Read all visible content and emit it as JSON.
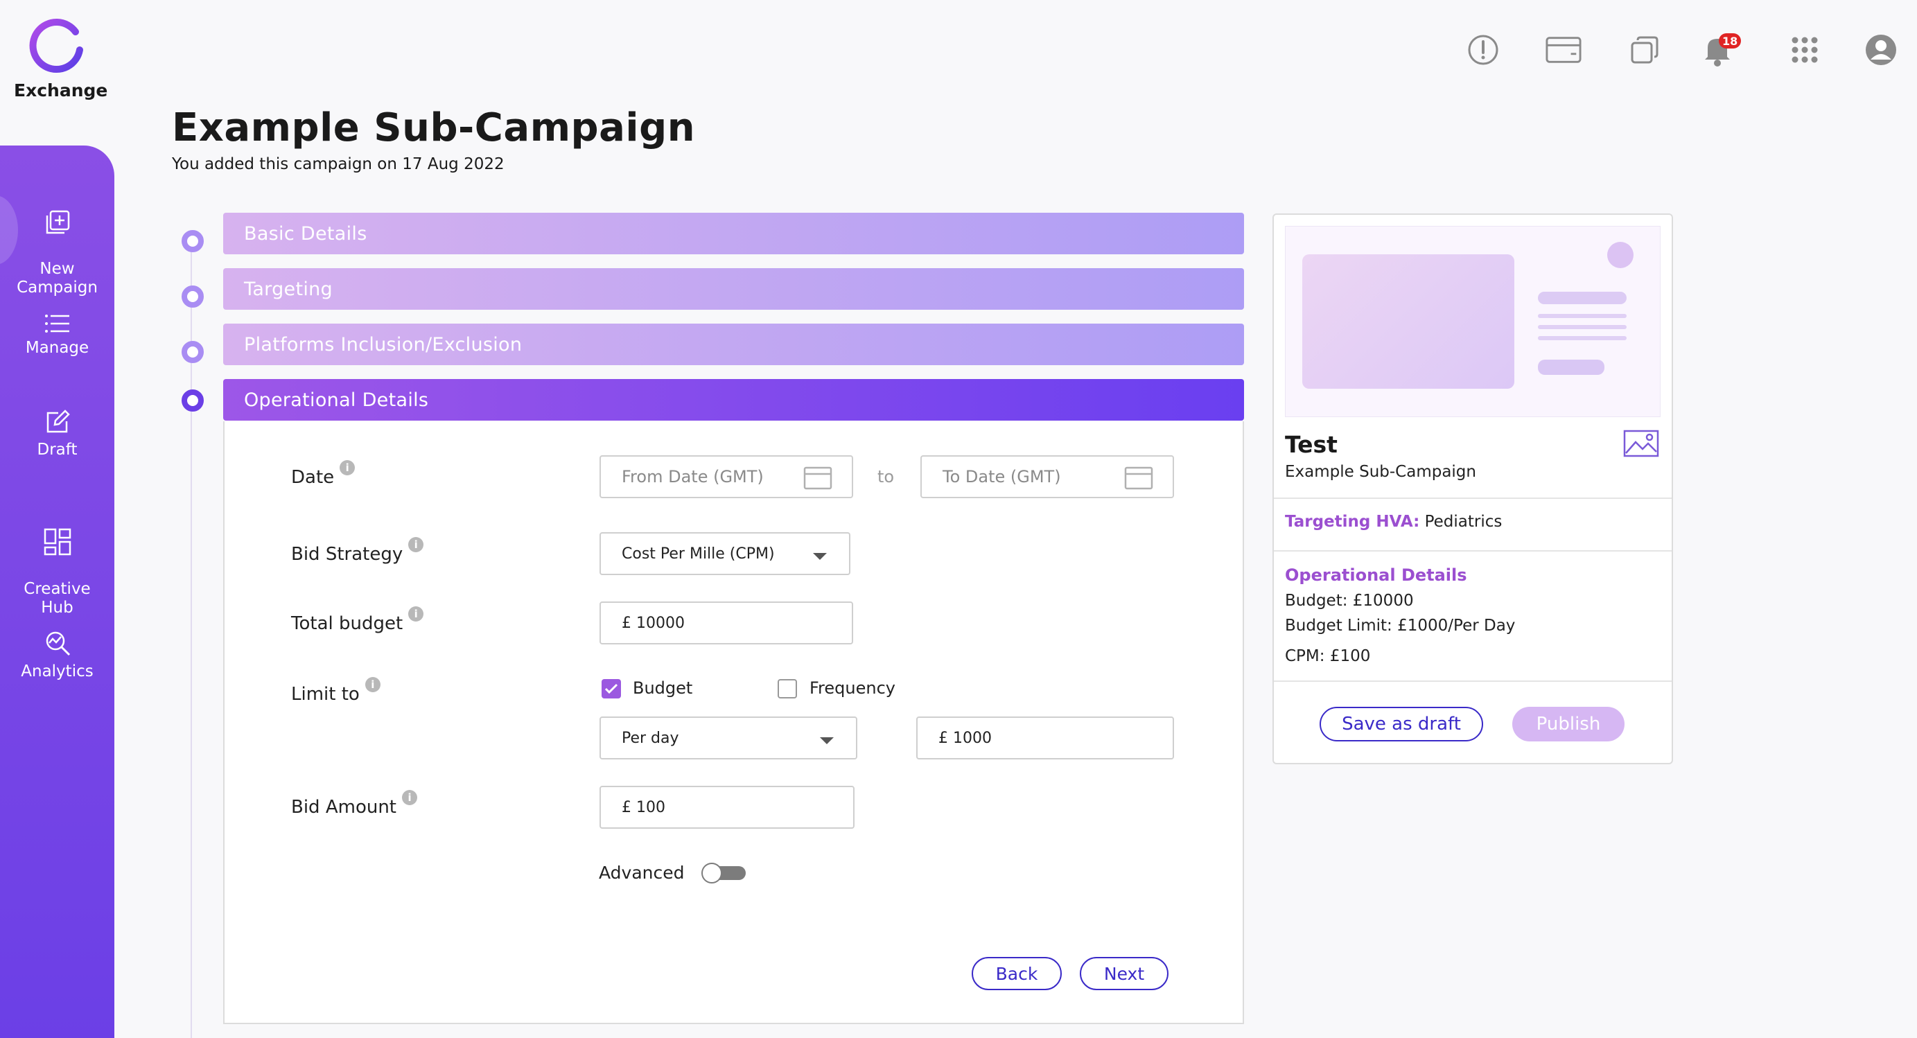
{
  "app": {
    "logo_text": "Exchange"
  },
  "sidebar": {
    "items": [
      {
        "label": "New\nCampaign",
        "icon": "new-campaign-icon"
      },
      {
        "label": "Manage",
        "icon": "list-icon"
      },
      {
        "label": "Draft",
        "icon": "edit-icon"
      },
      {
        "label": "Creative\nHub",
        "icon": "grid-icon"
      },
      {
        "label": "Analytics",
        "icon": "analytics-icon"
      }
    ]
  },
  "topbar": {
    "icons": [
      "alert-icon",
      "card-icon",
      "copy-icon",
      "bell-icon",
      "apps-icon",
      "user-icon"
    ],
    "notification_count": "18"
  },
  "page": {
    "title": "Example Sub-Campaign",
    "subtitle": "You added this campaign on 17 Aug 2022"
  },
  "steps": [
    {
      "label": "Basic Details",
      "active": false
    },
    {
      "label": "Targeting",
      "active": false
    },
    {
      "label": "Platforms Inclusion/Exclusion",
      "active": false
    },
    {
      "label": "Operational Details",
      "active": true
    }
  ],
  "form": {
    "date": {
      "label": "Date",
      "from_placeholder": "From Date (GMT)",
      "to_text": "to",
      "to_placeholder": "To Date (GMT)"
    },
    "bid_strategy": {
      "label": "Bid Strategy",
      "value": "Cost Per Mille (CPM)"
    },
    "total_budget": {
      "label": "Total budget",
      "value": "£ 10000"
    },
    "limit_to": {
      "label": "Limit to",
      "budget_label": "Budget",
      "budget_checked": true,
      "frequency_label": "Frequency",
      "frequency_checked": false,
      "period_value": "Per day",
      "amount_value": "£ 1000"
    },
    "bid_amount": {
      "label": "Bid Amount",
      "value": "£ 100"
    },
    "advanced": {
      "label": "Advanced",
      "on": false
    },
    "info_glyph": "i",
    "back_label": "Back",
    "next_label": "Next"
  },
  "preview": {
    "title": "Test",
    "subtitle": "Example Sub-Campaign",
    "targeting_key": "Targeting HVA:",
    "targeting_value": "Pediatrics",
    "ops_heading": "Operational Details",
    "budget": "Budget: £10000",
    "budget_limit": "Budget Limit: £1000/Per Day",
    "cpm": "CPM: £100",
    "save_label": "Save as draft",
    "publish_label": "Publish"
  },
  "colors": {
    "accent": "#6b3fe6",
    "accent_light": "#a98df3",
    "button_border": "#3a2ac8",
    "badge": "#e02424"
  }
}
